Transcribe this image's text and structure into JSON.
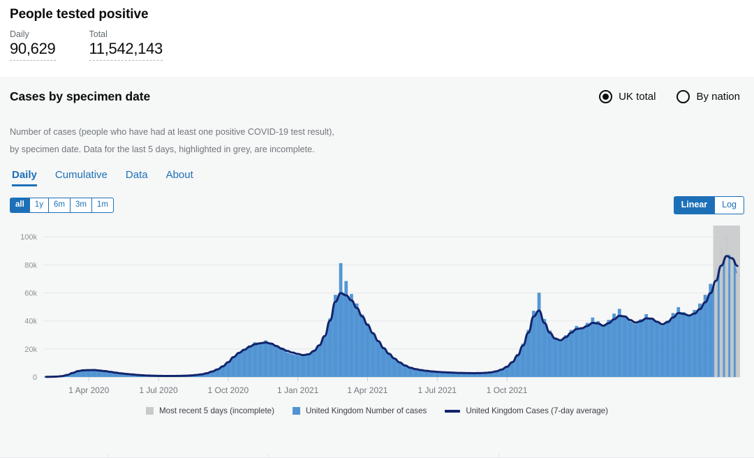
{
  "kpi": {
    "title": "People tested positive",
    "metrics": [
      {
        "label": "Daily",
        "value": "90,629"
      },
      {
        "label": "Total",
        "value": "11,542,143"
      }
    ]
  },
  "card": {
    "title": "Cases by specimen date",
    "scope_options": [
      {
        "label": "UK total",
        "selected": true
      },
      {
        "label": "By nation",
        "selected": false
      }
    ],
    "description": [
      "Number of cases (people who have had at least one positive COVID-19 test result),",
      "by specimen date. Data for the last 5 days, highlighted in grey, are incomplete."
    ],
    "tabs": [
      {
        "label": "Daily",
        "active": true
      },
      {
        "label": "Cumulative",
        "active": false
      },
      {
        "label": "Data",
        "active": false
      },
      {
        "label": "About",
        "active": false
      }
    ],
    "range_buttons": [
      {
        "label": "all",
        "active": true
      },
      {
        "label": "1y",
        "active": false
      },
      {
        "label": "6m",
        "active": false
      },
      {
        "label": "3m",
        "active": false
      },
      {
        "label": "1m",
        "active": false
      }
    ],
    "scale_buttons": [
      {
        "label": "Linear",
        "active": true
      },
      {
        "label": "Log",
        "active": false
      }
    ]
  },
  "colors": {
    "accent_blue": "#1d70b8",
    "bar_blue": "#5194d3",
    "line_navy": "#12256b",
    "incomplete_grey": "#c8cacb",
    "card_bg": "#f6f7f7",
    "text_muted": "#6f777b"
  },
  "chart_data": {
    "type": "bar",
    "title": "Cases by specimen date",
    "xlabel": "",
    "ylabel": "",
    "grid": true,
    "legend_position": "bottom",
    "ylim": [
      0,
      108000
    ],
    "ytick_labels": [
      "0",
      "20k",
      "40k",
      "60k",
      "80k",
      "100k"
    ],
    "ytick_values": [
      0,
      20000,
      40000,
      60000,
      80000,
      100000
    ],
    "xtick_labels": [
      "1 Apr 2020",
      "1 Jul 2020",
      "1 Oct 2020",
      "1 Jan 2021",
      "1 Apr 2021",
      "1 Jul 2021",
      "1 Oct 2021"
    ],
    "xtick_indices": [
      8,
      21,
      34,
      47,
      60,
      73,
      86
    ],
    "x_start": "2020-02-01",
    "x_end": "2021-12-20",
    "bin_label": "weekly-sampled",
    "series": [
      {
        "name": "United Kingdom Number of cases",
        "type": "bar",
        "color": "#5194d3",
        "values": [
          120,
          180,
          300,
          700,
          1600,
          3200,
          4600,
          5200,
          4900,
          5400,
          4700,
          4300,
          3900,
          3200,
          2700,
          2300,
          1900,
          1500,
          1200,
          1000,
          900,
          800,
          750,
          700,
          760,
          820,
          900,
          1100,
          1400,
          1800,
          2600,
          3800,
          5200,
          7400,
          10800,
          14600,
          17800,
          20100,
          22600,
          24800,
          23900,
          26100,
          24300,
          21800,
          19600,
          17400,
          16200,
          15400,
          14800,
          15600,
          18200,
          22400,
          29600,
          41800,
          58600,
          81200,
          68400,
          59200,
          52400,
          44600,
          38200,
          31600,
          25800,
          20400,
          16200,
          12600,
          9800,
          7600,
          6200,
          5400,
          4800,
          4300,
          3900,
          3600,
          3400,
          3200,
          3050,
          2900,
          2800,
          2750,
          2700,
          2800,
          3000,
          3400,
          4200,
          5600,
          7800,
          11200,
          16400,
          23800,
          33600,
          47200,
          60100,
          41400,
          33200,
          28200,
          26400,
          29800,
          33600,
          36400,
          34200,
          38600,
          42400,
          39800,
          36200,
          40800,
          45200,
          48600,
          43800,
          39400,
          37600,
          41200,
          44800,
          42200,
          38600,
          36400,
          40200,
          45600,
          49800,
          46200,
          43600,
          47800,
          52400,
          58600,
          66400,
          78200,
          92600,
          101800,
          88400,
          74200
        ]
      },
      {
        "name": "United Kingdom Cases (7-day average)",
        "type": "line",
        "color": "#12256b",
        "values": [
          110,
          160,
          280,
          640,
          1500,
          2900,
          4200,
          4800,
          4900,
          4950,
          4600,
          4200,
          3700,
          3100,
          2600,
          2200,
          1850,
          1500,
          1250,
          1050,
          920,
          830,
          770,
          730,
          760,
          820,
          920,
          1120,
          1420,
          1850,
          2650,
          3900,
          5400,
          7600,
          10600,
          14200,
          17200,
          19400,
          21600,
          23400,
          24100,
          24600,
          23800,
          22100,
          20200,
          18600,
          17400,
          16400,
          15600,
          16200,
          18600,
          22600,
          29200,
          40200,
          53600,
          59800,
          58200,
          54600,
          49200,
          43200,
          37200,
          31200,
          25600,
          20600,
          16600,
          13200,
          10400,
          8200,
          6600,
          5600,
          4900,
          4400,
          4000,
          3700,
          3450,
          3250,
          3080,
          2950,
          2850,
          2780,
          2740,
          2800,
          2980,
          3320,
          4020,
          5300,
          7300,
          10600,
          15400,
          22400,
          31600,
          43200,
          47400,
          38600,
          31600,
          27400,
          26200,
          28400,
          31600,
          34200,
          34800,
          36400,
          38600,
          38200,
          36600,
          38400,
          41200,
          43600,
          43200,
          40600,
          38800,
          39800,
          41800,
          41600,
          39400,
          37600,
          39200,
          42400,
          45600,
          45000,
          43800,
          45200,
          48400,
          53200,
          59800,
          68600,
          79400,
          86200,
          84600,
          79200
        ]
      }
    ],
    "incomplete_region": {
      "label": "Most recent 5 days (incomplete)",
      "color": "#c8cacb",
      "start_index": 125,
      "end_index": 129
    },
    "legend": [
      {
        "label": "Most recent 5 days (incomplete)",
        "color": "#c8cacb",
        "marker": "square"
      },
      {
        "label": "United Kingdom Number of cases",
        "color": "#5194d3",
        "marker": "square"
      },
      {
        "label": "United Kingdom Cases (7-day average)",
        "color": "#12256b",
        "marker": "line"
      }
    ]
  }
}
